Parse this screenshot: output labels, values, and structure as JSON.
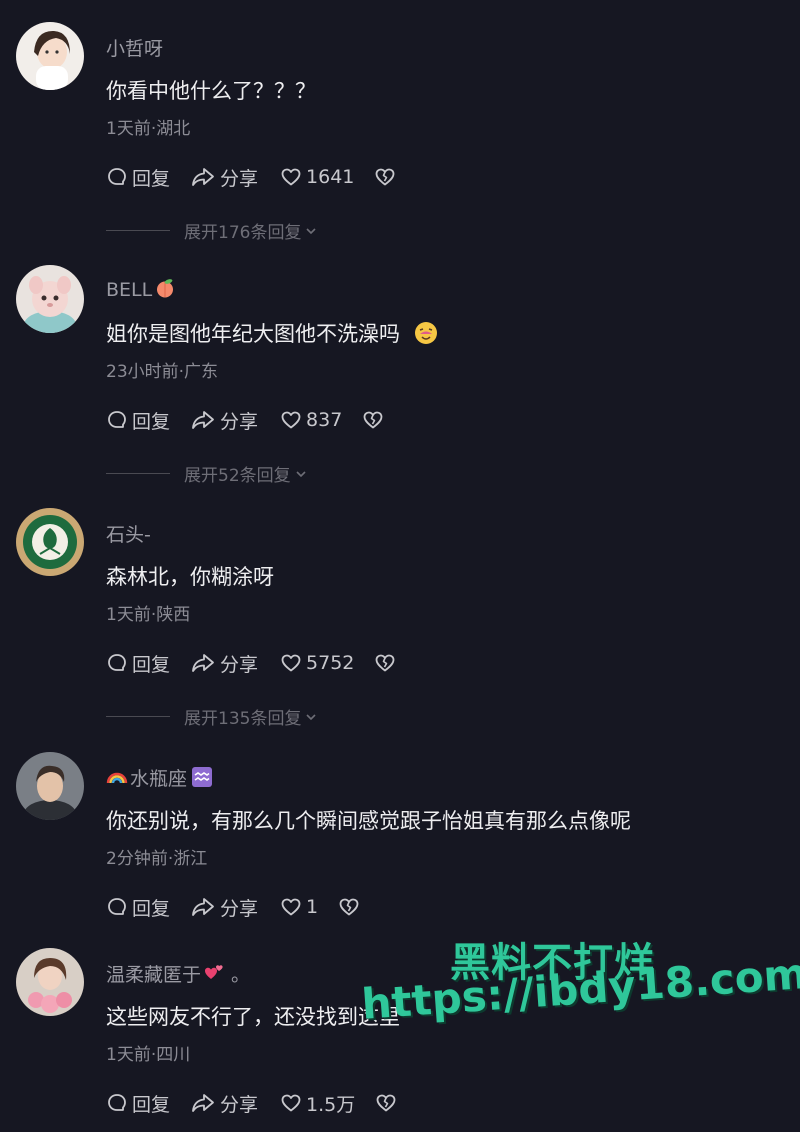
{
  "comments": [
    {
      "username": "小哲呀",
      "text": "你看中他什么了？？？",
      "meta": "1天前·湖北",
      "reply_label": "回复",
      "share_label": "分享",
      "likes": "1641",
      "expand_label": "展开176条回复"
    },
    {
      "username": "BELL",
      "text": "姐你是图他年纪大图他不洗澡吗",
      "meta": "23小时前·广东",
      "reply_label": "回复",
      "share_label": "分享",
      "likes": "837",
      "expand_label": "展开52条回复"
    },
    {
      "username": "石头-",
      "text": "森林北，你糊涂呀",
      "meta": "1天前·陕西",
      "reply_label": "回复",
      "share_label": "分享",
      "likes": "5752",
      "expand_label": "展开135条回复"
    },
    {
      "username": "水瓶座",
      "text": "你还别说，有那么几个瞬间感觉跟子怡姐真有那么点像呢",
      "meta": "2分钟前·浙江",
      "reply_label": "回复",
      "share_label": "分享",
      "likes": "1"
    },
    {
      "username": "温柔藏匿于",
      "username_suffix": "。",
      "text": "这些网友不行了，还没找到这里",
      "meta": "1天前·四川",
      "reply_label": "回复",
      "share_label": "分享",
      "likes": "1.5万"
    }
  ],
  "watermark": {
    "line1": "黑料不打烊",
    "line2": "https://ibdy18.com"
  },
  "colors": {
    "background": "#161722",
    "watermark": "#2fc79a"
  }
}
